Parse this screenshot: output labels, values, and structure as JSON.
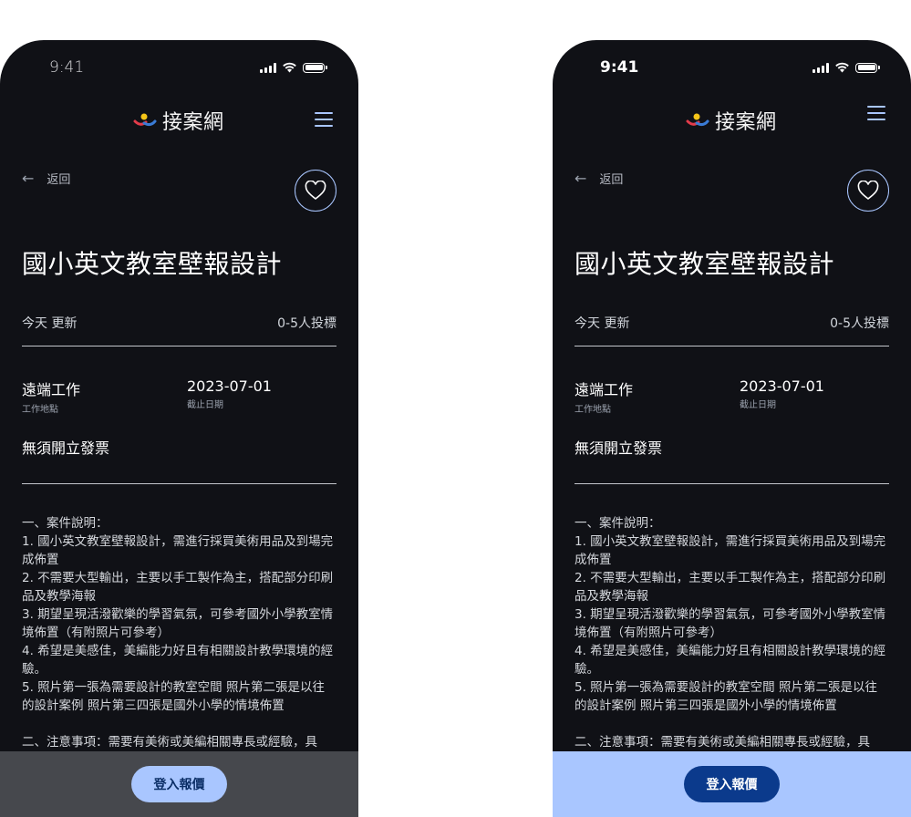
{
  "colors": {
    "background": "#101116",
    "accent": "#a9c6ff",
    "cta_dark": "#0b3a8c",
    "bar_gray": "#46484d"
  },
  "status": {
    "time": "9:41"
  },
  "header": {
    "brand": "接案網",
    "logo_icon": "brand-logo-icon",
    "menu_icon": "hamburger-menu-icon"
  },
  "nav": {
    "back_label": "返回",
    "back_icon": "arrow-left-icon",
    "favorite_icon": "heart-icon"
  },
  "project": {
    "title": "國小英文教室壁報設計",
    "updated": "今天 更新",
    "bidders": "0-5人投標",
    "location_value": "遠端工作",
    "location_label": "工作地點",
    "deadline_value": "2023-07-01",
    "deadline_label": "截止日期",
    "invoice": "無須開立發票",
    "description": [
      "一、案件說明：",
      " 1. 國小英文教室壁報設計，需進行採買美術用品及到場完成佈置",
      "2. 不需要大型輸出，主要以手工製作為主，搭配部分印刷品及教學海報",
      "3. 期望呈現活潑歡樂的學習氣氛，可參考國外小學教室情境佈置（有附照片可參考）",
      "4. 希望是美感佳，美編能力好且有相關設計教學環境的經驗。",
      "5. 照片第一張為需要設計的教室空間 照片第二張是以往的設計案例 照片第三四張是國外小學的情境佈置"
    ],
    "notes_partial": "二、注意事項：需要有美術或美編相關專長或經驗，具"
  },
  "cta": {
    "label": "登入報價"
  }
}
